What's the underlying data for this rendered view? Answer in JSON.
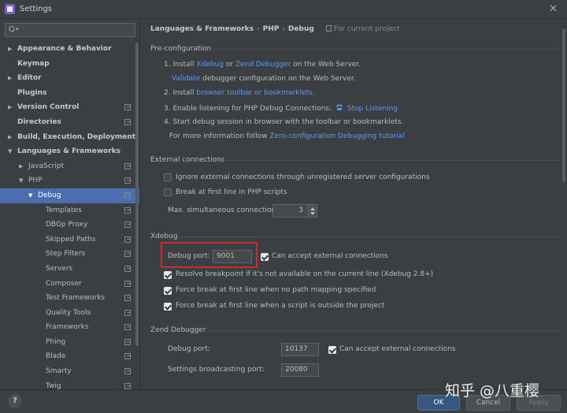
{
  "window": {
    "title": "Settings"
  },
  "search": {
    "placeholder": "Q•"
  },
  "sidebar": {
    "items": [
      {
        "label": "Appearance & Behavior",
        "arrow": "▶",
        "bold": true
      },
      {
        "label": "Keymap",
        "bold": true
      },
      {
        "label": "Editor",
        "arrow": "▶",
        "bold": true
      },
      {
        "label": "Plugins",
        "bold": true
      },
      {
        "label": "Version Control",
        "arrow": "▶",
        "bold": true,
        "copy": true
      },
      {
        "label": "Directories",
        "bold": true,
        "copy": true
      },
      {
        "label": "Build, Execution, Deployment",
        "arrow": "▶",
        "bold": true
      },
      {
        "label": "Languages & Frameworks",
        "arrow": "▼",
        "bold": true
      },
      {
        "label": "JavaScript",
        "arrow": "▶",
        "copy": true
      },
      {
        "label": "PHP",
        "arrow": "▼",
        "copy": true
      },
      {
        "label": "Debug",
        "arrow": "▼",
        "copy": true,
        "selected": true
      },
      {
        "label": "Templates",
        "copy": true
      },
      {
        "label": "DBGp Proxy",
        "copy": true
      },
      {
        "label": "Skipped Paths",
        "copy": true
      },
      {
        "label": "Step Filters",
        "copy": true
      },
      {
        "label": "Servers",
        "copy": true
      },
      {
        "label": "Composer",
        "copy": true
      },
      {
        "label": "Test Frameworks",
        "copy": true
      },
      {
        "label": "Quality Tools",
        "copy": true
      },
      {
        "label": "Frameworks",
        "copy": true
      },
      {
        "label": "Phing",
        "copy": true
      },
      {
        "label": "Blade",
        "copy": true
      },
      {
        "label": "Smarty",
        "copy": true
      },
      {
        "label": "Twig",
        "copy": true
      }
    ]
  },
  "breadcrumb": {
    "items": [
      "Languages & Frameworks",
      "PHP",
      "Debug"
    ],
    "separator": "›",
    "note": "For current project"
  },
  "preconfig": {
    "title": "Pre-configuration",
    "step1_prefix": "1. Install",
    "step1_link1": "Xdebug",
    "step1_or": "or",
    "step1_link2": "Zend Debugger",
    "step1_suffix": "on the Web Server.",
    "validate_link": "Validate",
    "validate_suffix": "debugger configuration on the Web Server.",
    "step2_prefix": "2. Install",
    "step2_link": "browser toolbar or bookmarklets.",
    "step3_prefix": "3. Enable listening for PHP Debug Connections:",
    "step3_link": "Stop Listening",
    "step4": "4. Start debug session in browser with the toolbar or bookmarklets.",
    "more_prefix": "For more information follow",
    "more_link": "Zero-configuration Debugging tutorial"
  },
  "external": {
    "title": "External connections",
    "ignore_label": "Ignore external connections through unregistered server configurations",
    "break_label": "Break at first line in PHP scripts",
    "max_label": "Max. simultaneous connections:",
    "max_value": "3"
  },
  "xdebug": {
    "title": "Xdebug",
    "port_label": "Debug port:",
    "port_value": "9001",
    "accept_label": "Can accept external connections",
    "resolve_label": "Resolve breakpoint if it's not available on the current line (Xdebug 2.8+)",
    "force_path_label": "Force break at first line when no path mapping specified",
    "force_outside_label": "Force break at first line when a script is outside the project"
  },
  "zend": {
    "title": "Zend Debugger",
    "port_label": "Debug port:",
    "port_value": "10137",
    "accept_label": "Can accept external connections",
    "broadcast_label": "Settings broadcasting port:",
    "broadcast_value": "20080"
  },
  "footer": {
    "help": "?",
    "ok": "OK",
    "cancel": "Cancel",
    "apply": "Apply"
  },
  "watermark": {
    "text": "知乎 @八重樱"
  },
  "colors": {
    "link": "#589df6",
    "selection": "#4b6eaf",
    "highlight": "#d02b2b",
    "ok": "#365880"
  }
}
